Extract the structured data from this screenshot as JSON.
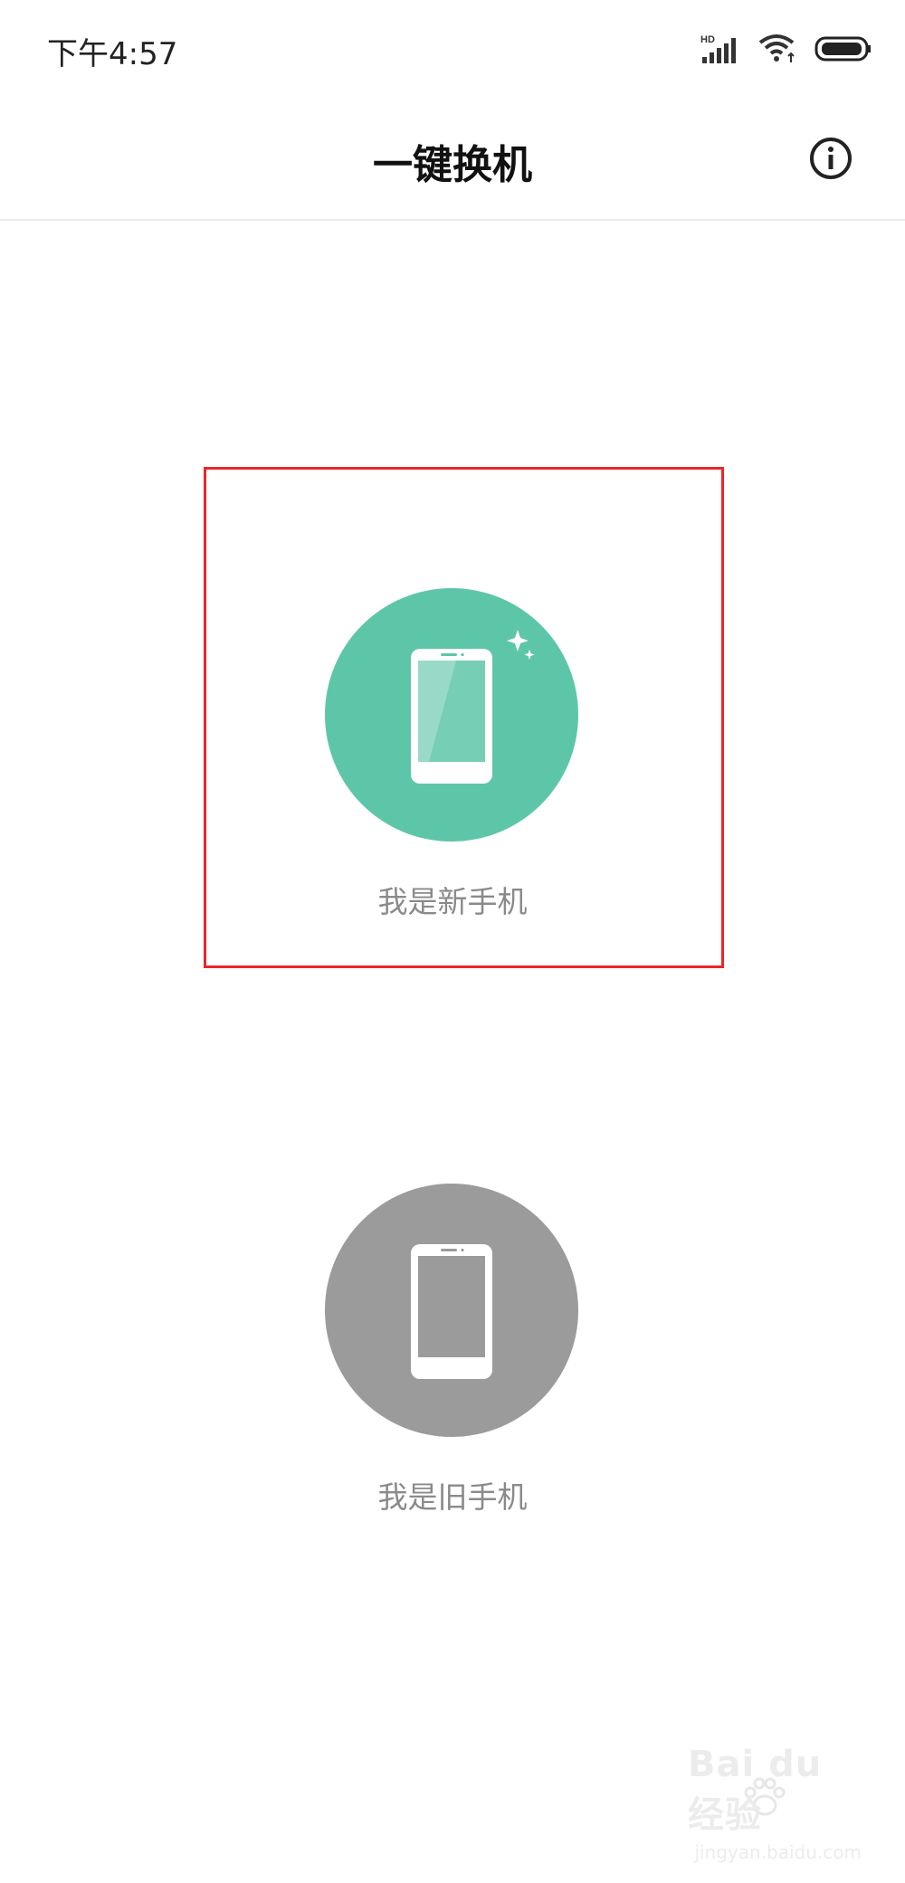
{
  "status_bar": {
    "time": "下午4:57",
    "signal_label": "HD"
  },
  "header": {
    "title": "一键换机"
  },
  "options": {
    "new_phone": {
      "label": "我是新手机",
      "color": "#5ec6a8"
    },
    "old_phone": {
      "label": "我是旧手机",
      "color": "#9b9b9b"
    }
  },
  "watermark": {
    "text": "Bai du 经验",
    "sub": "jingyan.baidu.com"
  }
}
